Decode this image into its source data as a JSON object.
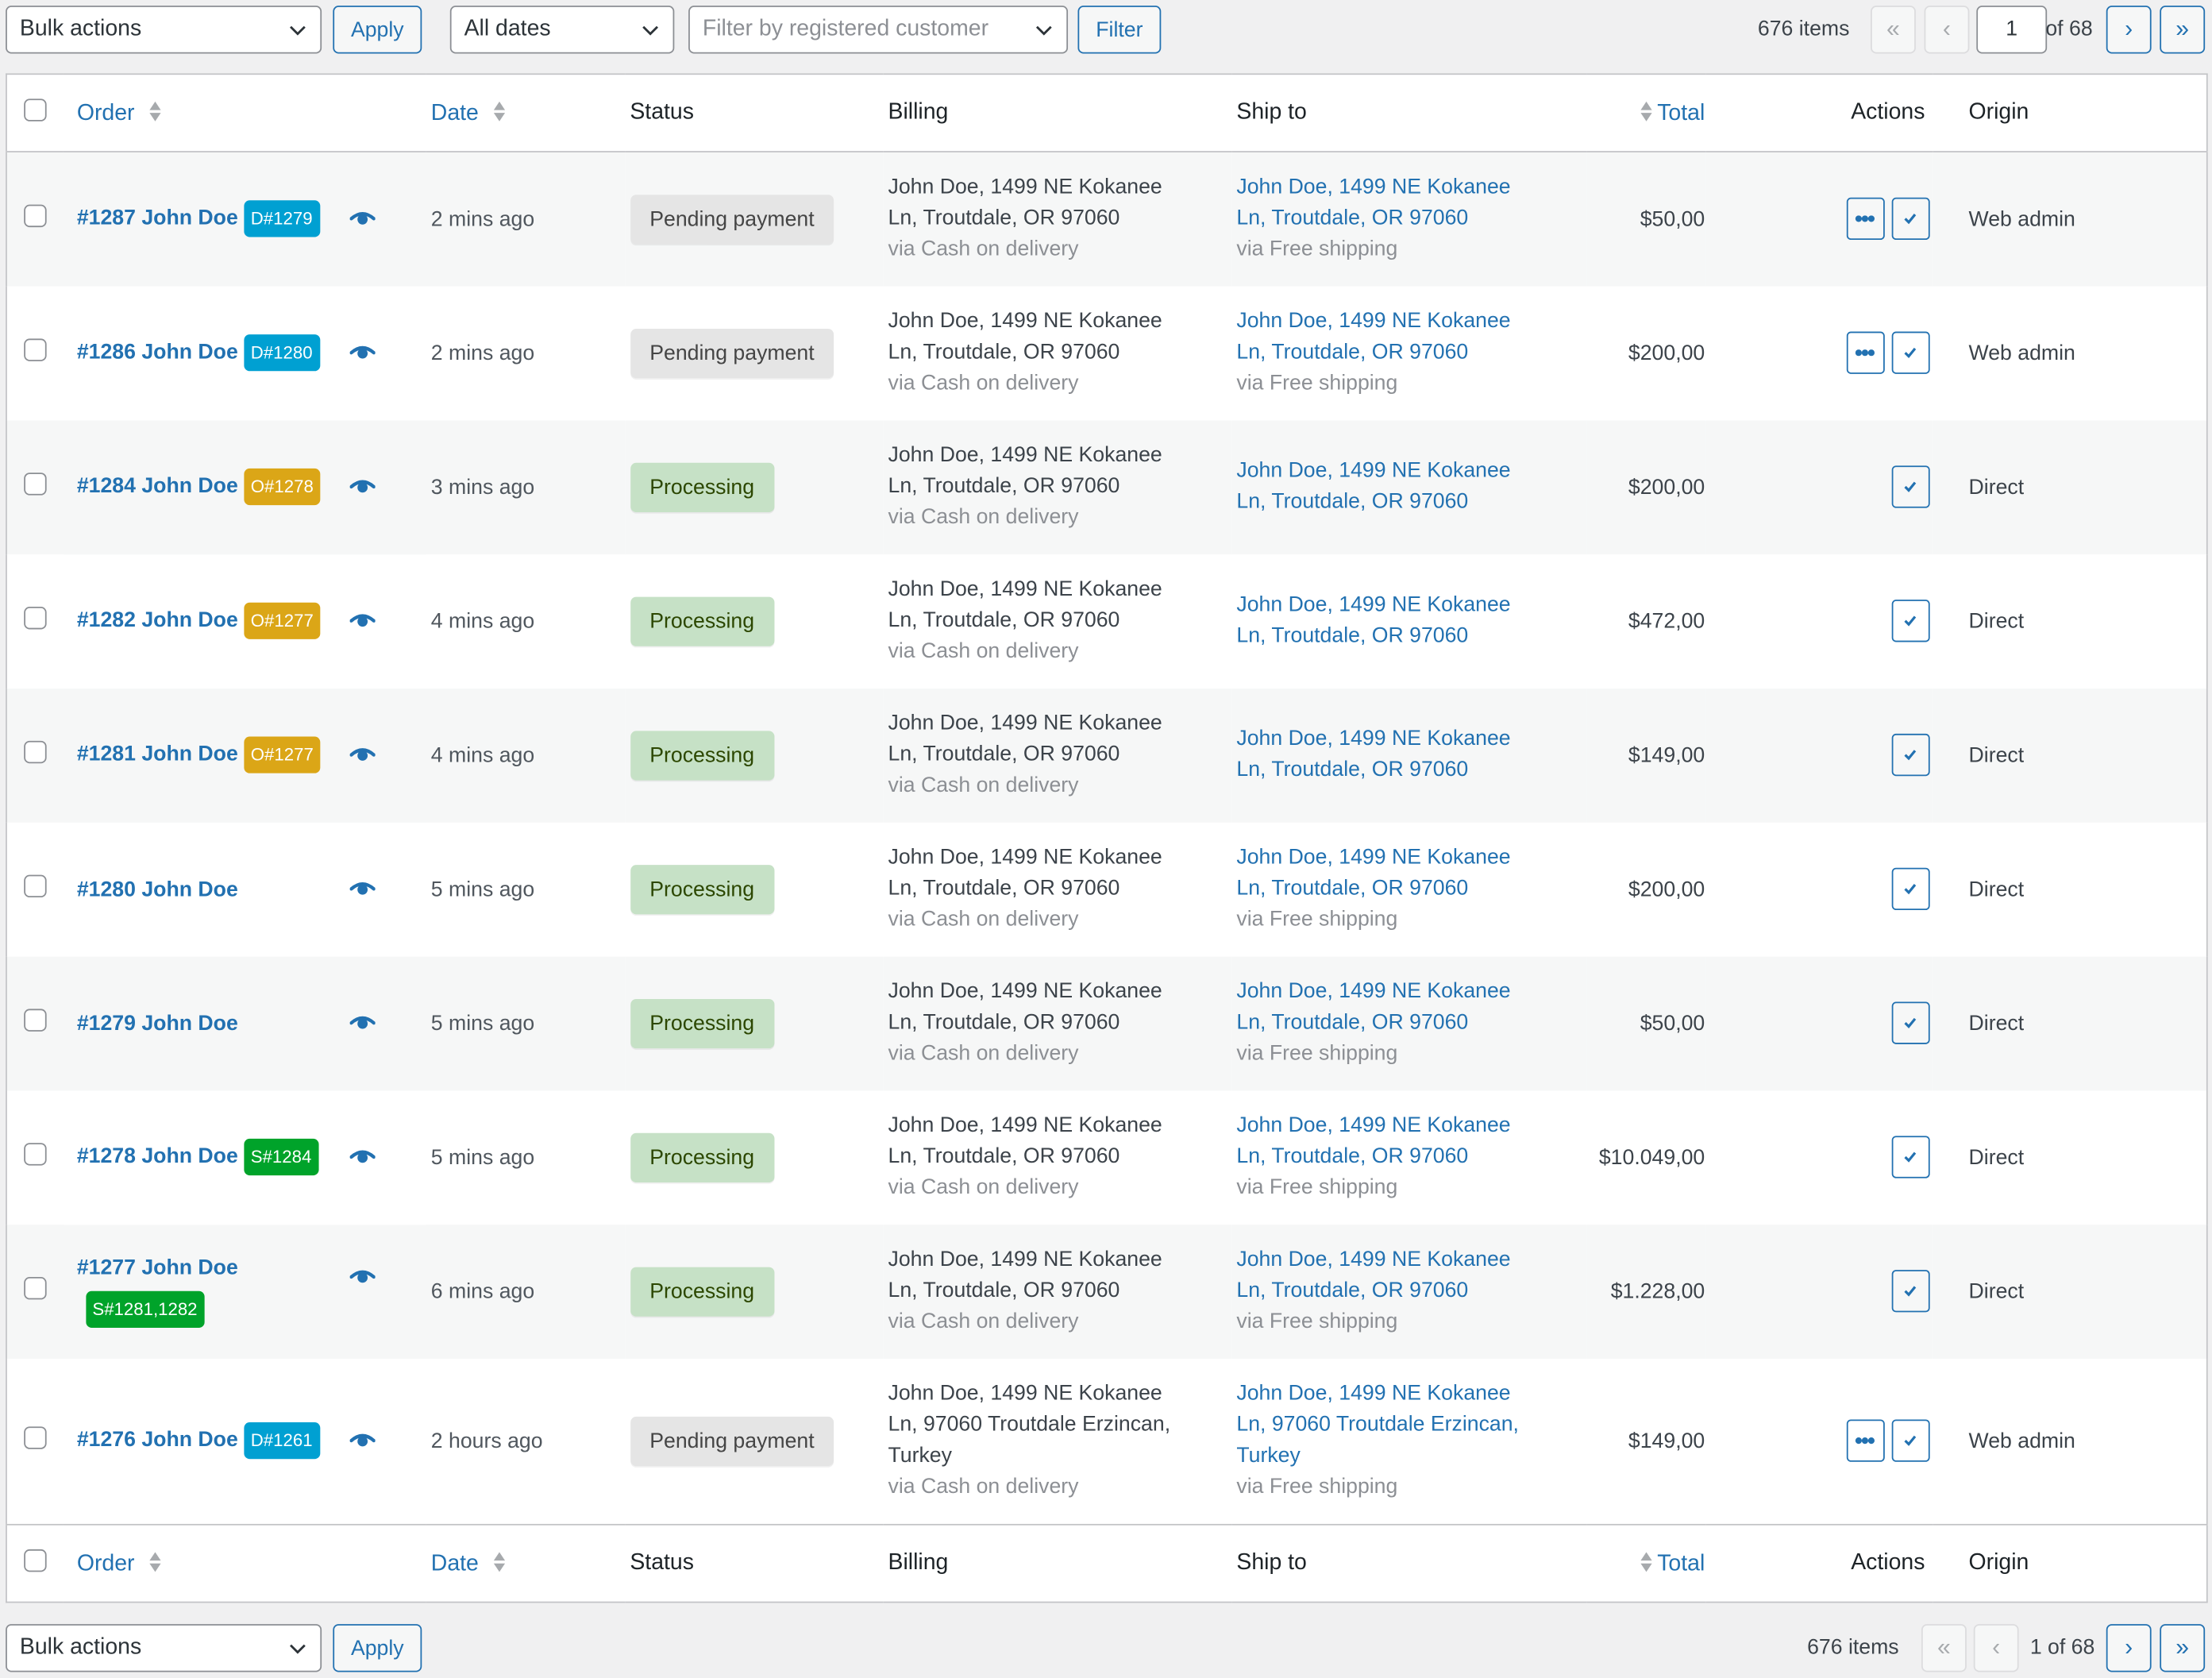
{
  "top_nav": {
    "bulk_actions": "Bulk actions",
    "apply": "Apply",
    "date_filter": "All dates",
    "customer_filter_placeholder": "Filter by registered customer",
    "filter": "Filter",
    "items_count": "676 items",
    "first_page": "«",
    "prev_page": "‹",
    "current_page": "1",
    "of_pages": "of 68",
    "next_page": "›",
    "last_page": "»"
  },
  "columns": {
    "order": "Order",
    "date": "Date",
    "status": "Status",
    "billing": "Billing",
    "ship_to": "Ship to",
    "total": "Total",
    "actions": "Actions",
    "origin": "Origin"
  },
  "badge_colors": {
    "D": "#00a0d2",
    "O": "#dba617",
    "S": "#00a32a"
  },
  "status_styles": {
    "Pending payment": {
      "bg": "#e5e5e5",
      "fg": "#454545"
    },
    "Processing": {
      "bg": "#c6e1c6",
      "fg": "#2c4700"
    }
  },
  "orders": [
    {
      "order": "#1287 John Doe",
      "badge": "D#1279",
      "badge_type": "D",
      "date": "2 mins ago",
      "status": "Pending payment",
      "billing": [
        "John Doe, 1499 NE Kokanee",
        "Ln, Troutdale, OR 97060"
      ],
      "billing_via": "via Cash on delivery",
      "ship": [
        "John Doe, 1499 NE Kokanee",
        "Ln, Troutdale, OR 97060"
      ],
      "ship_via": "via Free shipping",
      "total": "$50,00",
      "actions": [
        "more",
        "complete"
      ],
      "origin": "Web admin"
    },
    {
      "order": "#1286 John Doe",
      "badge": "D#1280",
      "badge_type": "D",
      "date": "2 mins ago",
      "status": "Pending payment",
      "billing": [
        "John Doe, 1499 NE Kokanee",
        "Ln, Troutdale, OR 97060"
      ],
      "billing_via": "via Cash on delivery",
      "ship": [
        "John Doe, 1499 NE Kokanee",
        "Ln, Troutdale, OR 97060"
      ],
      "ship_via": "via Free shipping",
      "total": "$200,00",
      "actions": [
        "more",
        "complete"
      ],
      "origin": "Web admin"
    },
    {
      "order": "#1284 John Doe",
      "badge": "O#1278",
      "badge_type": "O",
      "date": "3 mins ago",
      "status": "Processing",
      "billing": [
        "John Doe, 1499 NE Kokanee",
        "Ln, Troutdale, OR 97060"
      ],
      "billing_via": "via Cash on delivery",
      "ship": [
        "John Doe, 1499 NE Kokanee",
        "Ln, Troutdale, OR 97060"
      ],
      "ship_via": "",
      "total": "$200,00",
      "actions": [
        "complete"
      ],
      "origin": "Direct"
    },
    {
      "order": "#1282 John Doe",
      "badge": "O#1277",
      "badge_type": "O",
      "date": "4 mins ago",
      "status": "Processing",
      "billing": [
        "John Doe, 1499 NE Kokanee",
        "Ln, Troutdale, OR 97060"
      ],
      "billing_via": "via Cash on delivery",
      "ship": [
        "John Doe, 1499 NE Kokanee",
        "Ln, Troutdale, OR 97060"
      ],
      "ship_via": "",
      "total": "$472,00",
      "actions": [
        "complete"
      ],
      "origin": "Direct"
    },
    {
      "order": "#1281 John Doe",
      "badge": "O#1277",
      "badge_type": "O",
      "date": "4 mins ago",
      "status": "Processing",
      "billing": [
        "John Doe, 1499 NE Kokanee",
        "Ln, Troutdale, OR 97060"
      ],
      "billing_via": "via Cash on delivery",
      "ship": [
        "John Doe, 1499 NE Kokanee",
        "Ln, Troutdale, OR 97060"
      ],
      "ship_via": "",
      "total": "$149,00",
      "actions": [
        "complete"
      ],
      "origin": "Direct"
    },
    {
      "order": "#1280 John Doe",
      "badge": "",
      "badge_type": "",
      "date": "5 mins ago",
      "status": "Processing",
      "billing": [
        "John Doe, 1499 NE Kokanee",
        "Ln, Troutdale, OR 97060"
      ],
      "billing_via": "via Cash on delivery",
      "ship": [
        "John Doe, 1499 NE Kokanee",
        "Ln, Troutdale, OR 97060"
      ],
      "ship_via": "via Free shipping",
      "total": "$200,00",
      "actions": [
        "complete"
      ],
      "origin": "Direct"
    },
    {
      "order": "#1279 John Doe",
      "badge": "",
      "badge_type": "",
      "date": "5 mins ago",
      "status": "Processing",
      "billing": [
        "John Doe, 1499 NE Kokanee",
        "Ln, Troutdale, OR 97060"
      ],
      "billing_via": "via Cash on delivery",
      "ship": [
        "John Doe, 1499 NE Kokanee",
        "Ln, Troutdale, OR 97060"
      ],
      "ship_via": "via Free shipping",
      "total": "$50,00",
      "actions": [
        "complete"
      ],
      "origin": "Direct"
    },
    {
      "order": "#1278 John Doe",
      "badge": "S#1284",
      "badge_type": "S",
      "date": "5 mins ago",
      "status": "Processing",
      "billing": [
        "John Doe, 1499 NE Kokanee",
        "Ln, Troutdale, OR 97060"
      ],
      "billing_via": "via Cash on delivery",
      "ship": [
        "John Doe, 1499 NE Kokanee",
        "Ln, Troutdale, OR 97060"
      ],
      "ship_via": "via Free shipping",
      "total": "$10.049,00",
      "actions": [
        "complete"
      ],
      "origin": "Direct"
    },
    {
      "order": "#1277 John Doe",
      "badge": "S#1281,1282",
      "badge_type": "S",
      "badge_wrap": true,
      "date": "6 mins ago",
      "status": "Processing",
      "billing": [
        "John Doe, 1499 NE Kokanee",
        "Ln, Troutdale, OR 97060"
      ],
      "billing_via": "via Cash on delivery",
      "ship": [
        "John Doe, 1499 NE Kokanee",
        "Ln, Troutdale, OR 97060"
      ],
      "ship_via": "via Free shipping",
      "total": "$1.228,00",
      "actions": [
        "complete"
      ],
      "origin": "Direct"
    },
    {
      "order": "#1276 John Doe",
      "badge": "D#1261",
      "badge_type": "D",
      "date": "2 hours ago",
      "status": "Pending payment",
      "billing": [
        "John Doe, 1499 NE Kokanee",
        "Ln, 97060 Troutdale Erzincan,",
        "Turkey"
      ],
      "billing_via": "via Cash on delivery",
      "ship": [
        "John Doe, 1499 NE Kokanee",
        "Ln, 97060 Troutdale Erzincan,",
        "Turkey"
      ],
      "ship_via": "via Free shipping",
      "total": "$149,00",
      "actions": [
        "more",
        "complete"
      ],
      "origin": "Web admin"
    }
  ],
  "bottom_nav": {
    "bulk_actions": "Bulk actions",
    "apply": "Apply",
    "items_count": "676 items",
    "first_page": "«",
    "prev_page": "‹",
    "page_status": "1 of 68",
    "next_page": "›",
    "last_page": "»"
  }
}
